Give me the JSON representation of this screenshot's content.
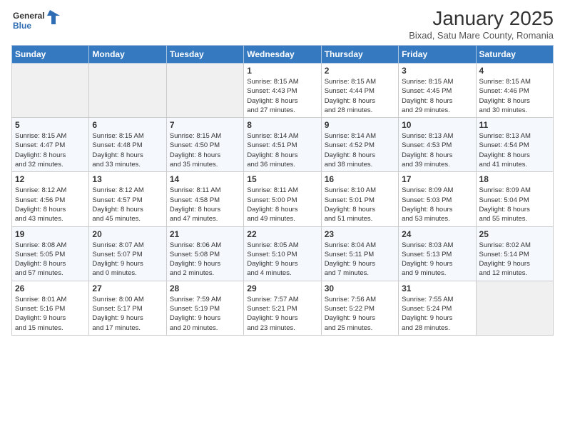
{
  "logo": {
    "general": "General",
    "blue": "Blue"
  },
  "title": "January 2025",
  "location": "Bixad, Satu Mare County, Romania",
  "weekdays": [
    "Sunday",
    "Monday",
    "Tuesday",
    "Wednesday",
    "Thursday",
    "Friday",
    "Saturday"
  ],
  "weeks": [
    [
      {
        "day": "",
        "info": ""
      },
      {
        "day": "",
        "info": ""
      },
      {
        "day": "",
        "info": ""
      },
      {
        "day": "1",
        "info": "Sunrise: 8:15 AM\nSunset: 4:43 PM\nDaylight: 8 hours\nand 27 minutes."
      },
      {
        "day": "2",
        "info": "Sunrise: 8:15 AM\nSunset: 4:44 PM\nDaylight: 8 hours\nand 28 minutes."
      },
      {
        "day": "3",
        "info": "Sunrise: 8:15 AM\nSunset: 4:45 PM\nDaylight: 8 hours\nand 29 minutes."
      },
      {
        "day": "4",
        "info": "Sunrise: 8:15 AM\nSunset: 4:46 PM\nDaylight: 8 hours\nand 30 minutes."
      }
    ],
    [
      {
        "day": "5",
        "info": "Sunrise: 8:15 AM\nSunset: 4:47 PM\nDaylight: 8 hours\nand 32 minutes."
      },
      {
        "day": "6",
        "info": "Sunrise: 8:15 AM\nSunset: 4:48 PM\nDaylight: 8 hours\nand 33 minutes."
      },
      {
        "day": "7",
        "info": "Sunrise: 8:15 AM\nSunset: 4:50 PM\nDaylight: 8 hours\nand 35 minutes."
      },
      {
        "day": "8",
        "info": "Sunrise: 8:14 AM\nSunset: 4:51 PM\nDaylight: 8 hours\nand 36 minutes."
      },
      {
        "day": "9",
        "info": "Sunrise: 8:14 AM\nSunset: 4:52 PM\nDaylight: 8 hours\nand 38 minutes."
      },
      {
        "day": "10",
        "info": "Sunrise: 8:13 AM\nSunset: 4:53 PM\nDaylight: 8 hours\nand 39 minutes."
      },
      {
        "day": "11",
        "info": "Sunrise: 8:13 AM\nSunset: 4:54 PM\nDaylight: 8 hours\nand 41 minutes."
      }
    ],
    [
      {
        "day": "12",
        "info": "Sunrise: 8:12 AM\nSunset: 4:56 PM\nDaylight: 8 hours\nand 43 minutes."
      },
      {
        "day": "13",
        "info": "Sunrise: 8:12 AM\nSunset: 4:57 PM\nDaylight: 8 hours\nand 45 minutes."
      },
      {
        "day": "14",
        "info": "Sunrise: 8:11 AM\nSunset: 4:58 PM\nDaylight: 8 hours\nand 47 minutes."
      },
      {
        "day": "15",
        "info": "Sunrise: 8:11 AM\nSunset: 5:00 PM\nDaylight: 8 hours\nand 49 minutes."
      },
      {
        "day": "16",
        "info": "Sunrise: 8:10 AM\nSunset: 5:01 PM\nDaylight: 8 hours\nand 51 minutes."
      },
      {
        "day": "17",
        "info": "Sunrise: 8:09 AM\nSunset: 5:03 PM\nDaylight: 8 hours\nand 53 minutes."
      },
      {
        "day": "18",
        "info": "Sunrise: 8:09 AM\nSunset: 5:04 PM\nDaylight: 8 hours\nand 55 minutes."
      }
    ],
    [
      {
        "day": "19",
        "info": "Sunrise: 8:08 AM\nSunset: 5:05 PM\nDaylight: 8 hours\nand 57 minutes."
      },
      {
        "day": "20",
        "info": "Sunrise: 8:07 AM\nSunset: 5:07 PM\nDaylight: 9 hours\nand 0 minutes."
      },
      {
        "day": "21",
        "info": "Sunrise: 8:06 AM\nSunset: 5:08 PM\nDaylight: 9 hours\nand 2 minutes."
      },
      {
        "day": "22",
        "info": "Sunrise: 8:05 AM\nSunset: 5:10 PM\nDaylight: 9 hours\nand 4 minutes."
      },
      {
        "day": "23",
        "info": "Sunrise: 8:04 AM\nSunset: 5:11 PM\nDaylight: 9 hours\nand 7 minutes."
      },
      {
        "day": "24",
        "info": "Sunrise: 8:03 AM\nSunset: 5:13 PM\nDaylight: 9 hours\nand 9 minutes."
      },
      {
        "day": "25",
        "info": "Sunrise: 8:02 AM\nSunset: 5:14 PM\nDaylight: 9 hours\nand 12 minutes."
      }
    ],
    [
      {
        "day": "26",
        "info": "Sunrise: 8:01 AM\nSunset: 5:16 PM\nDaylight: 9 hours\nand 15 minutes."
      },
      {
        "day": "27",
        "info": "Sunrise: 8:00 AM\nSunset: 5:17 PM\nDaylight: 9 hours\nand 17 minutes."
      },
      {
        "day": "28",
        "info": "Sunrise: 7:59 AM\nSunset: 5:19 PM\nDaylight: 9 hours\nand 20 minutes."
      },
      {
        "day": "29",
        "info": "Sunrise: 7:57 AM\nSunset: 5:21 PM\nDaylight: 9 hours\nand 23 minutes."
      },
      {
        "day": "30",
        "info": "Sunrise: 7:56 AM\nSunset: 5:22 PM\nDaylight: 9 hours\nand 25 minutes."
      },
      {
        "day": "31",
        "info": "Sunrise: 7:55 AM\nSunset: 5:24 PM\nDaylight: 9 hours\nand 28 minutes."
      },
      {
        "day": "",
        "info": ""
      }
    ]
  ]
}
